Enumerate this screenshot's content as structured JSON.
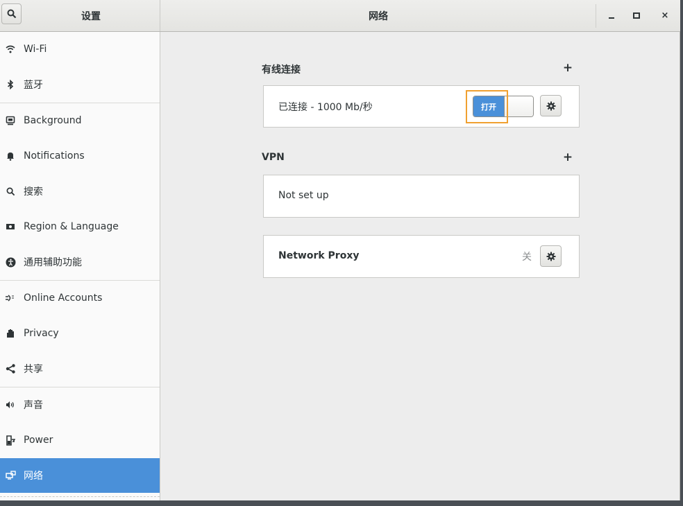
{
  "header": {
    "sidebar_title": "设置",
    "title": "网络",
    "search_icon": "search-icon",
    "controls": {
      "minimize": "minimize-icon",
      "maximize": "maximize-icon",
      "close": "×"
    }
  },
  "sidebar": {
    "items": [
      {
        "label": "Wi-Fi",
        "icon": "wifi-icon",
        "selected": false
      },
      {
        "label": "蓝牙",
        "icon": "bluetooth-icon",
        "selected": false
      },
      {
        "label": "Background",
        "icon": "background-icon",
        "selected": false
      },
      {
        "label": "Notifications",
        "icon": "notifications-icon",
        "selected": false
      },
      {
        "label": "搜索",
        "icon": "search-icon",
        "selected": false
      },
      {
        "label": "Region & Language",
        "icon": "region-icon",
        "selected": false
      },
      {
        "label": "通用辅助功能",
        "icon": "accessibility-icon",
        "selected": false
      },
      {
        "label": "Online Accounts",
        "icon": "online-accounts-icon",
        "selected": false
      },
      {
        "label": "Privacy",
        "icon": "privacy-hand-icon",
        "selected": false
      },
      {
        "label": "共享",
        "icon": "share-icon",
        "selected": false
      },
      {
        "label": "声音",
        "icon": "sound-icon",
        "selected": false
      },
      {
        "label": "Power",
        "icon": "power-icon",
        "selected": false
      },
      {
        "label": "网络",
        "icon": "network-icon",
        "selected": true
      }
    ]
  },
  "main": {
    "wired": {
      "title": "有线连接",
      "add": "+",
      "status": "已连接 - 1000 Mb/秒",
      "switch_label": "打开",
      "switch_on": true
    },
    "vpn": {
      "title": "VPN",
      "add": "+",
      "status": "Not set up"
    },
    "proxy": {
      "label": "Network Proxy",
      "state": "关"
    }
  },
  "colors": {
    "accent": "#4a90d9",
    "highlight": "#f0a030",
    "background": "#ededed"
  }
}
